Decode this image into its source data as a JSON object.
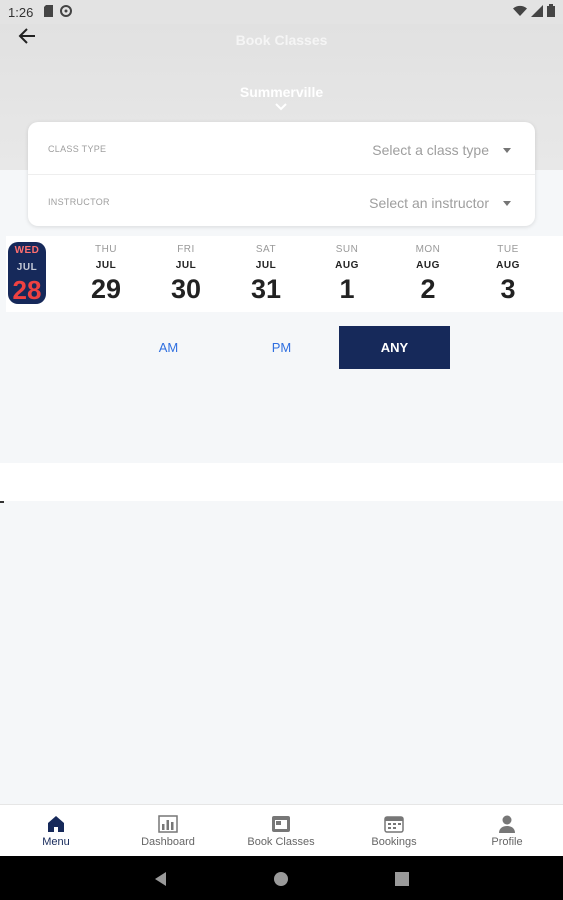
{
  "status_bar": {
    "time": "1:26"
  },
  "header": {
    "title": "Book Classes",
    "location": "Summerville"
  },
  "filters": {
    "class_type": {
      "label": "CLASS TYPE",
      "value": "Select a class type"
    },
    "instructor": {
      "label": "INSTRUCTOR",
      "value": "Select an instructor"
    }
  },
  "days": [
    {
      "dow": "WED",
      "month": "JUL",
      "day": "28",
      "selected": true
    },
    {
      "dow": "THU",
      "month": "JUL",
      "day": "29"
    },
    {
      "dow": "FRI",
      "month": "JUL",
      "day": "30"
    },
    {
      "dow": "SAT",
      "month": "JUL",
      "day": "31"
    },
    {
      "dow": "SUN",
      "month": "AUG",
      "day": "1"
    },
    {
      "dow": "MON",
      "month": "AUG",
      "day": "2"
    },
    {
      "dow": "TUE",
      "month": "AUG",
      "day": "3"
    }
  ],
  "time_filter": {
    "am": "AM",
    "pm": "PM",
    "any": "ANY",
    "selected": "ANY"
  },
  "bottom_nav": [
    {
      "label": "Menu",
      "icon": "home-icon"
    },
    {
      "label": "Dashboard",
      "icon": "bar-chart-icon"
    },
    {
      "label": "Book Classes",
      "icon": "book-classes-icon"
    },
    {
      "label": "Bookings",
      "icon": "calendar-icon"
    },
    {
      "label": "Profile",
      "icon": "person-icon"
    }
  ],
  "colors": {
    "primary": "#16295a",
    "accent_red": "#ef4141",
    "link_blue": "#2f6fe0"
  }
}
